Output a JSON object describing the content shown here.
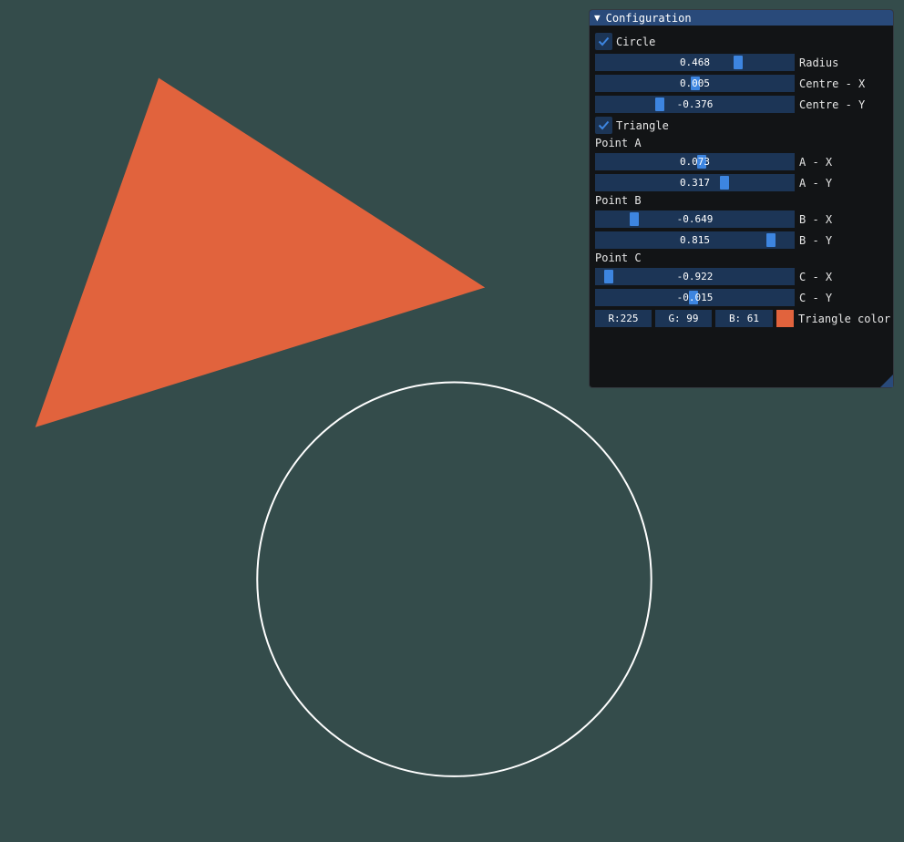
{
  "window": {
    "title": "Configuration",
    "collapse_icon": "triangle-down-icon"
  },
  "circle": {
    "checkbox_label": "Circle",
    "checked": true,
    "radius": {
      "value": 0.468,
      "display": "0.468",
      "label": "Radius"
    },
    "centre_x": {
      "value": 0.005,
      "display": "0.005",
      "label": "Centre - X"
    },
    "centre_y": {
      "value": -0.376,
      "display": "-0.376",
      "label": "Centre - Y"
    },
    "stroke_color": "#ffffff"
  },
  "triangle": {
    "checkbox_label": "Triangle",
    "checked": true,
    "point_a": {
      "heading": "Point A",
      "x": {
        "value": 0.073,
        "display": "0.073",
        "label": "A - X"
      },
      "y": {
        "value": 0.317,
        "display": "0.317",
        "label": "A - Y"
      }
    },
    "point_b": {
      "heading": "Point B",
      "x": {
        "value": -0.649,
        "display": "-0.649",
        "label": "B - X"
      },
      "y": {
        "value": 0.815,
        "display": "0.815",
        "label": "B - Y"
      }
    },
    "point_c": {
      "heading": "Point C",
      "x": {
        "value": -0.922,
        "display": "-0.922",
        "label": "C - X"
      },
      "y": {
        "value": -0.015,
        "display": "-0.015",
        "label": "C - Y"
      }
    },
    "color": {
      "r_display": "R:225",
      "g_display": "G: 99",
      "b_display": "B: 61",
      "hex": "#e1633d",
      "label": "Triangle color"
    }
  },
  "colors": {
    "background": "#344c4b",
    "panel_bg": "#121416",
    "title_bar": "#294a7a",
    "frame_bg": "#1c3556",
    "slider_grab": "#3d85e0"
  }
}
